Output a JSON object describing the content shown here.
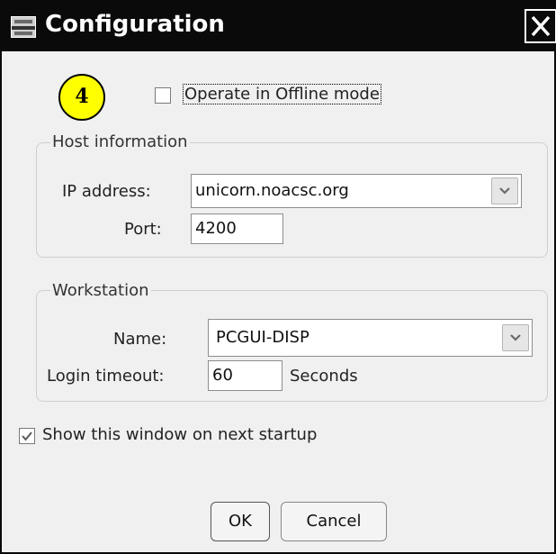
{
  "window": {
    "title": "Configuration",
    "close_icon": "close-icon",
    "app_icon": "app-icon"
  },
  "step_badge": "4",
  "offline": {
    "label": "Operate in Offline mode",
    "checked": false
  },
  "host": {
    "legend": "Host information",
    "ip_label": "IP address:",
    "ip_value": "unicorn.noacsc.org",
    "port_label": "Port:",
    "port_value": "4200"
  },
  "workstation": {
    "legend": "Workstation",
    "name_label": "Name:",
    "name_value": "PCGUI-DISP",
    "timeout_label": "Login timeout:",
    "timeout_value": "60",
    "timeout_unit": "Seconds"
  },
  "startup": {
    "label": "Show this window on next startup",
    "checked": true
  },
  "buttons": {
    "ok": "OK",
    "cancel": "Cancel"
  }
}
